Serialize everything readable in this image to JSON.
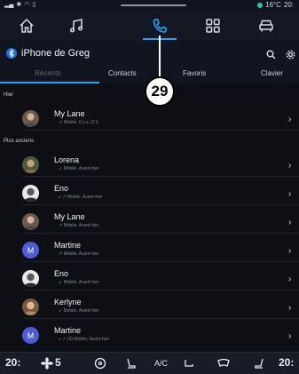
{
  "status": {
    "temperature": "16°C",
    "time": "20:"
  },
  "nav": {
    "items": [
      {
        "name": "home-nav-icon"
      },
      {
        "name": "music-nav-icon"
      },
      {
        "name": "phone-nav-icon"
      },
      {
        "name": "apps-nav-icon"
      },
      {
        "name": "car-nav-icon"
      }
    ],
    "active": "phone"
  },
  "header": {
    "title": "iPhone de Greg"
  },
  "tabs": [
    {
      "label": "Récents"
    },
    {
      "label": "Contacts"
    },
    {
      "label": "Favoris"
    },
    {
      "label": "Clavier"
    }
  ],
  "callout": "29",
  "sections": {
    "yesterday": "Hier",
    "older": "Plus anciens"
  },
  "calls": [
    {
      "name": "My Lane",
      "meta": "Mobile, Il y a 12 h",
      "avatar": "photo",
      "initial": ""
    },
    {
      "name": "Lorena",
      "meta": "Mobile, Avant-hier",
      "avatar": "photo",
      "initial": ""
    },
    {
      "name": "Eno",
      "meta": "Mobile, Avant-hier",
      "avatar": "photo",
      "initial": ""
    },
    {
      "name": "My Lane",
      "meta": "Mobile, Avant-hier",
      "avatar": "photo",
      "initial": ""
    },
    {
      "name": "Martine",
      "meta": "Mobile, Avant-hier",
      "avatar": "initial",
      "initial": "M"
    },
    {
      "name": "Eno",
      "meta": "Mobile, Avant-hier",
      "avatar": "photo",
      "initial": ""
    },
    {
      "name": "Kerlyne",
      "meta": "Mobile, Avant-hier",
      "avatar": "photo",
      "initial": ""
    },
    {
      "name": "Martine",
      "meta": "(3) Mobile, Avant-hier",
      "avatar": "initial",
      "initial": "M"
    }
  ],
  "bottom": {
    "left_temp": "20:",
    "fan_level": "5",
    "ac_label": "A/C",
    "right_temp": "20:"
  }
}
